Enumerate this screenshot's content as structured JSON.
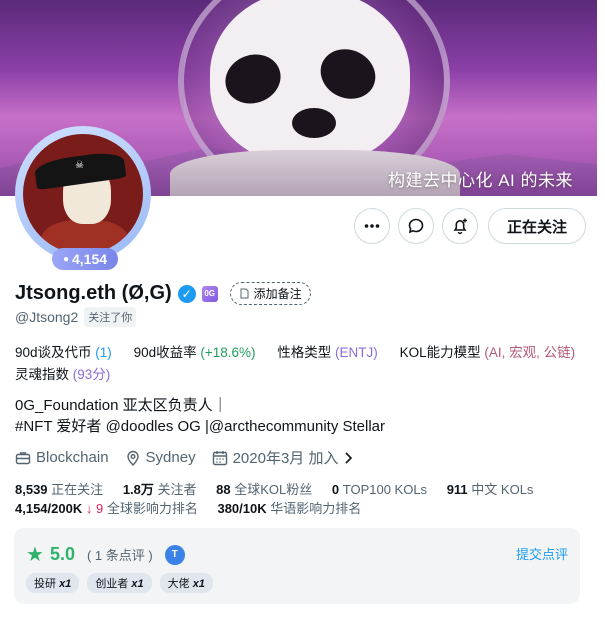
{
  "banner": {
    "text": "构建去中心化 AI 的未来"
  },
  "avatar": {
    "score": "4,154"
  },
  "actions": {
    "follow_label": "正在关注"
  },
  "profile": {
    "name": "Jtsong.eth (Ø,G)",
    "og_badge": "0G",
    "note_label": "添加备注",
    "handle": "@Jtsong2",
    "follows_you": "关注了你"
  },
  "stats": {
    "mentions_label": "90d谈及代币",
    "mentions_value": "(1)",
    "yield_label": "90d收益率",
    "yield_value": "(+18.6%)",
    "personality_label": "性格类型",
    "personality_value": "(ENTJ)",
    "kol_label": "KOL能力模型",
    "kol_value": "(AI, 宏观, 公链)",
    "soul_label": "灵魂指数",
    "soul_value": "(93分)"
  },
  "bio": {
    "line1": "0G_Foundation 亚太区负责人｜",
    "line2": "#NFT 爱好者 @doodles OG |@arcthecommunity Stellar"
  },
  "meta": {
    "category": "Blockchain",
    "location": "Sydney",
    "joined": "2020年3月 加入"
  },
  "counts": {
    "following_value": "8,539",
    "following_label": "正在关注",
    "followers_value": "1.8万",
    "followers_label": "关注者",
    "global_kol_value": "88",
    "global_kol_label": "全球KOL粉丝",
    "top100_value": "0",
    "top100_label": "TOP100 KOLs",
    "chinese_kol_value": "911",
    "chinese_kol_label": "中文 KOLs",
    "global_rank_value": "4,154/200K",
    "global_rank_change": "↓ 9",
    "global_rank_label": "全球影响力排名",
    "chinese_rank_value": "380/10K",
    "chinese_rank_label": "华语影响力排名"
  },
  "review": {
    "score": "5.0",
    "count": "( 1 条点评 )",
    "reviewer_initial": "T",
    "submit_label": "提交点评",
    "tags": [
      {
        "label": "投研",
        "mult": "x1"
      },
      {
        "label": "创业者",
        "mult": "x1"
      },
      {
        "label": "大佬",
        "mult": "x1"
      }
    ]
  },
  "colors": {
    "accent": "#1d9bf0",
    "green": "#1f9e5b",
    "purple": "#8b6cd8",
    "review_green": "#2fb36b"
  }
}
